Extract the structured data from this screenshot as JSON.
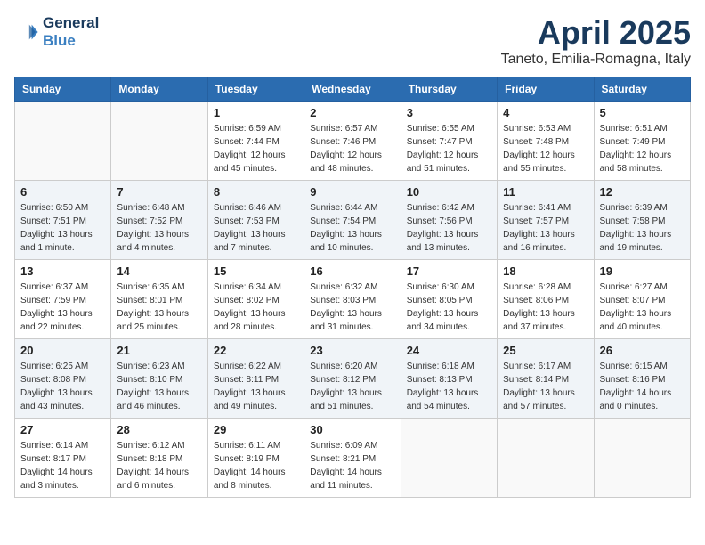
{
  "header": {
    "logo_line1": "General",
    "logo_line2": "Blue",
    "month": "April 2025",
    "location": "Taneto, Emilia-Romagna, Italy"
  },
  "weekdays": [
    "Sunday",
    "Monday",
    "Tuesday",
    "Wednesday",
    "Thursday",
    "Friday",
    "Saturday"
  ],
  "weeks": [
    [
      {
        "day": "",
        "info": ""
      },
      {
        "day": "",
        "info": ""
      },
      {
        "day": "1",
        "info": "Sunrise: 6:59 AM\nSunset: 7:44 PM\nDaylight: 12 hours\nand 45 minutes."
      },
      {
        "day": "2",
        "info": "Sunrise: 6:57 AM\nSunset: 7:46 PM\nDaylight: 12 hours\nand 48 minutes."
      },
      {
        "day": "3",
        "info": "Sunrise: 6:55 AM\nSunset: 7:47 PM\nDaylight: 12 hours\nand 51 minutes."
      },
      {
        "day": "4",
        "info": "Sunrise: 6:53 AM\nSunset: 7:48 PM\nDaylight: 12 hours\nand 55 minutes."
      },
      {
        "day": "5",
        "info": "Sunrise: 6:51 AM\nSunset: 7:49 PM\nDaylight: 12 hours\nand 58 minutes."
      }
    ],
    [
      {
        "day": "6",
        "info": "Sunrise: 6:50 AM\nSunset: 7:51 PM\nDaylight: 13 hours\nand 1 minute."
      },
      {
        "day": "7",
        "info": "Sunrise: 6:48 AM\nSunset: 7:52 PM\nDaylight: 13 hours\nand 4 minutes."
      },
      {
        "day": "8",
        "info": "Sunrise: 6:46 AM\nSunset: 7:53 PM\nDaylight: 13 hours\nand 7 minutes."
      },
      {
        "day": "9",
        "info": "Sunrise: 6:44 AM\nSunset: 7:54 PM\nDaylight: 13 hours\nand 10 minutes."
      },
      {
        "day": "10",
        "info": "Sunrise: 6:42 AM\nSunset: 7:56 PM\nDaylight: 13 hours\nand 13 minutes."
      },
      {
        "day": "11",
        "info": "Sunrise: 6:41 AM\nSunset: 7:57 PM\nDaylight: 13 hours\nand 16 minutes."
      },
      {
        "day": "12",
        "info": "Sunrise: 6:39 AM\nSunset: 7:58 PM\nDaylight: 13 hours\nand 19 minutes."
      }
    ],
    [
      {
        "day": "13",
        "info": "Sunrise: 6:37 AM\nSunset: 7:59 PM\nDaylight: 13 hours\nand 22 minutes."
      },
      {
        "day": "14",
        "info": "Sunrise: 6:35 AM\nSunset: 8:01 PM\nDaylight: 13 hours\nand 25 minutes."
      },
      {
        "day": "15",
        "info": "Sunrise: 6:34 AM\nSunset: 8:02 PM\nDaylight: 13 hours\nand 28 minutes."
      },
      {
        "day": "16",
        "info": "Sunrise: 6:32 AM\nSunset: 8:03 PM\nDaylight: 13 hours\nand 31 minutes."
      },
      {
        "day": "17",
        "info": "Sunrise: 6:30 AM\nSunset: 8:05 PM\nDaylight: 13 hours\nand 34 minutes."
      },
      {
        "day": "18",
        "info": "Sunrise: 6:28 AM\nSunset: 8:06 PM\nDaylight: 13 hours\nand 37 minutes."
      },
      {
        "day": "19",
        "info": "Sunrise: 6:27 AM\nSunset: 8:07 PM\nDaylight: 13 hours\nand 40 minutes."
      }
    ],
    [
      {
        "day": "20",
        "info": "Sunrise: 6:25 AM\nSunset: 8:08 PM\nDaylight: 13 hours\nand 43 minutes."
      },
      {
        "day": "21",
        "info": "Sunrise: 6:23 AM\nSunset: 8:10 PM\nDaylight: 13 hours\nand 46 minutes."
      },
      {
        "day": "22",
        "info": "Sunrise: 6:22 AM\nSunset: 8:11 PM\nDaylight: 13 hours\nand 49 minutes."
      },
      {
        "day": "23",
        "info": "Sunrise: 6:20 AM\nSunset: 8:12 PM\nDaylight: 13 hours\nand 51 minutes."
      },
      {
        "day": "24",
        "info": "Sunrise: 6:18 AM\nSunset: 8:13 PM\nDaylight: 13 hours\nand 54 minutes."
      },
      {
        "day": "25",
        "info": "Sunrise: 6:17 AM\nSunset: 8:14 PM\nDaylight: 13 hours\nand 57 minutes."
      },
      {
        "day": "26",
        "info": "Sunrise: 6:15 AM\nSunset: 8:16 PM\nDaylight: 14 hours\nand 0 minutes."
      }
    ],
    [
      {
        "day": "27",
        "info": "Sunrise: 6:14 AM\nSunset: 8:17 PM\nDaylight: 14 hours\nand 3 minutes."
      },
      {
        "day": "28",
        "info": "Sunrise: 6:12 AM\nSunset: 8:18 PM\nDaylight: 14 hours\nand 6 minutes."
      },
      {
        "day": "29",
        "info": "Sunrise: 6:11 AM\nSunset: 8:19 PM\nDaylight: 14 hours\nand 8 minutes."
      },
      {
        "day": "30",
        "info": "Sunrise: 6:09 AM\nSunset: 8:21 PM\nDaylight: 14 hours\nand 11 minutes."
      },
      {
        "day": "",
        "info": ""
      },
      {
        "day": "",
        "info": ""
      },
      {
        "day": "",
        "info": ""
      }
    ]
  ]
}
